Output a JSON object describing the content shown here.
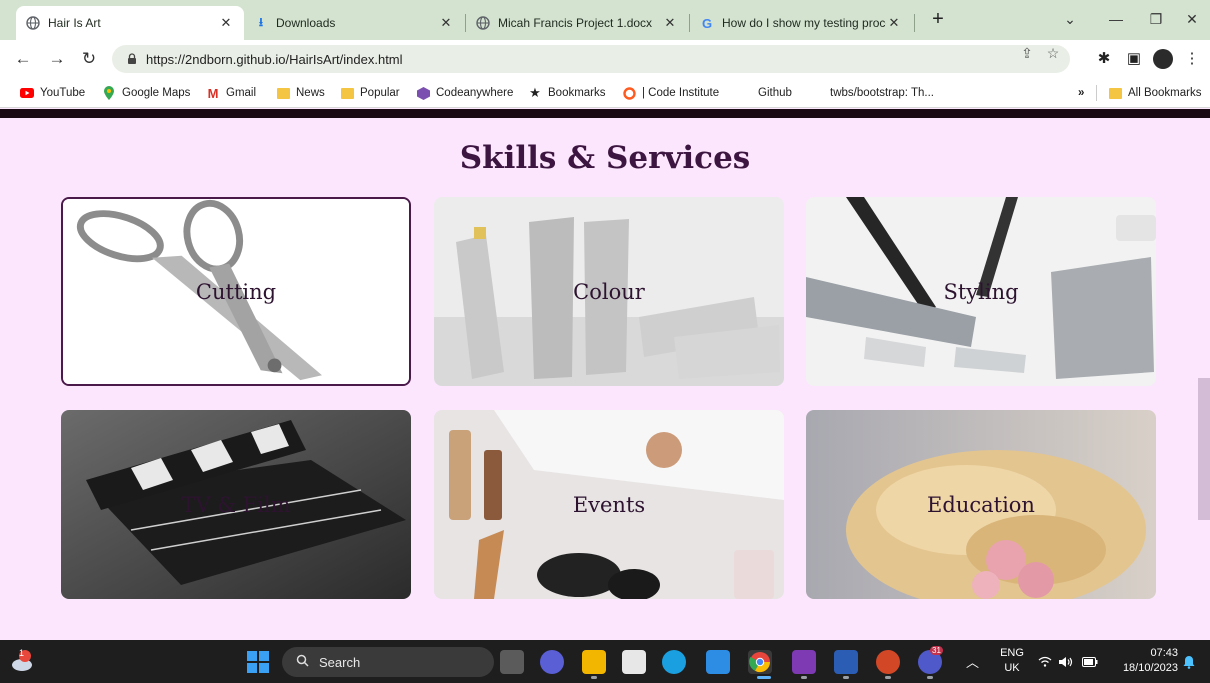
{
  "browser": {
    "tabs": [
      {
        "title": "Hair Is Art",
        "icon": "globe-icon",
        "active": true
      },
      {
        "title": "Downloads",
        "icon": "download-icon",
        "active": false
      },
      {
        "title": "Micah Francis Project 1.docx",
        "icon": "globe-icon",
        "active": false
      },
      {
        "title": "How do I show my testing proce",
        "icon": "google-icon",
        "active": false
      }
    ],
    "close_glyph": "✕",
    "new_tab_glyph": "+",
    "url": "https://2ndborn.github.io/HairIsArt/index.html",
    "bookmarks": [
      {
        "label": "YouTube",
        "icon": "youtube-icon"
      },
      {
        "label": "Google Maps",
        "icon": "maps-pin-icon"
      },
      {
        "label": "Gmail",
        "icon": "gmail-icon"
      },
      {
        "label": "News",
        "icon": "folder-icon"
      },
      {
        "label": "Popular",
        "icon": "folder-icon"
      },
      {
        "label": "Codeanywhere",
        "icon": "codeanywhere-icon"
      },
      {
        "label": "Bookmarks",
        "icon": "star-icon"
      },
      {
        "label": "| Code Institute",
        "icon": "code-institute-icon"
      },
      {
        "label": "Github",
        "icon": "none"
      },
      {
        "label": "twbs/bootstrap: Th...",
        "icon": "none"
      }
    ],
    "overflow_label": "»",
    "all_bookmarks_label": "All Bookmarks"
  },
  "page": {
    "section_title": "Skills & Services",
    "services": [
      {
        "label": "Cutting",
        "image": "scissors"
      },
      {
        "label": "Colour",
        "image": "colour-tubes"
      },
      {
        "label": "Styling",
        "image": "styling-products"
      },
      {
        "label": "TV & Film",
        "image": "clapperboard"
      },
      {
        "label": "Events",
        "image": "makeup-mirror"
      },
      {
        "label": "Education",
        "image": "blonde-updo"
      }
    ]
  },
  "taskbar": {
    "search_placeholder": "Search",
    "weather_badge": "1",
    "teams_badge": "31",
    "language": "ENG",
    "region": "UK",
    "time": "07:43",
    "date": "18/10/2023"
  },
  "colors": {
    "page_bg": "#fce6fd",
    "title_color": "#3c1640",
    "tab_strip": "#d3e3d0"
  }
}
